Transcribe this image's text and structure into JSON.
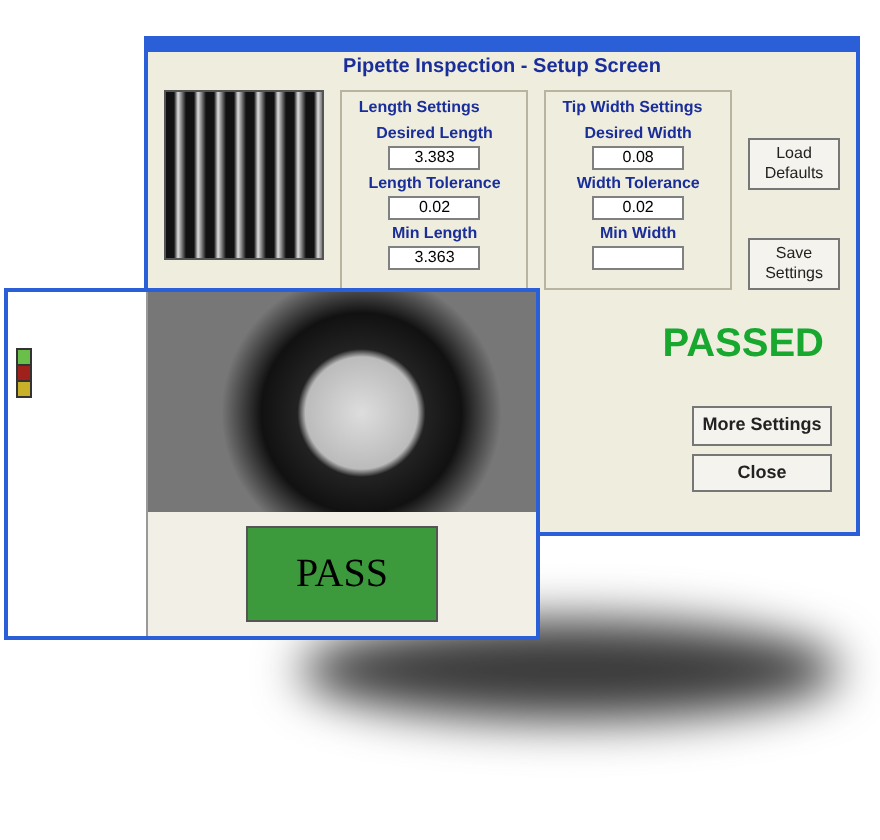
{
  "setup_window": {
    "title": "Pipette Inspection - Setup Screen",
    "length_settings": {
      "title": "Length Settings",
      "fields": [
        {
          "label": "Desired Length",
          "value": "3.383"
        },
        {
          "label": "Length Tolerance",
          "value": "0.02"
        },
        {
          "label": "Min Length",
          "value": "3.363"
        }
      ]
    },
    "tip_width_settings": {
      "title": "Tip Width Settings",
      "fields": [
        {
          "label": "Desired Width",
          "value": "0.08"
        },
        {
          "label": "Width Tolerance",
          "value": "0.02"
        },
        {
          "label": "Min Width"
        }
      ]
    },
    "side_buttons": [
      "Load Defaults",
      "Save Settings"
    ],
    "status": "PASSED",
    "bottom_buttons": [
      "More Settings",
      "Close"
    ]
  },
  "inspection_window": {
    "result": "PASS",
    "indicator_lights": [
      {
        "color": "#6abf4b"
      },
      {
        "color": "#a0201c"
      },
      {
        "color": "#c8b02a"
      }
    ]
  }
}
